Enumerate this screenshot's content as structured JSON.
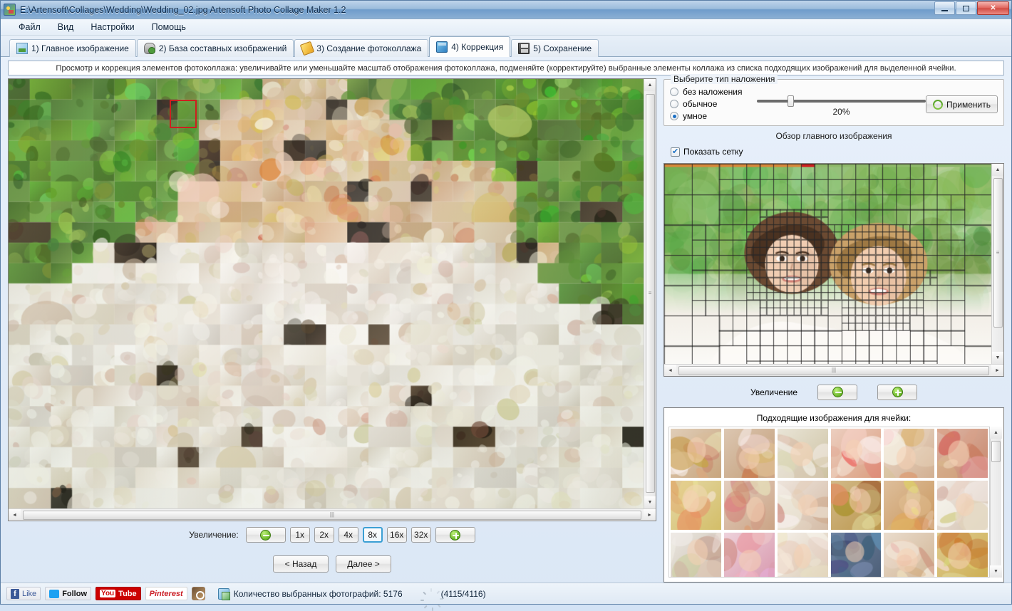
{
  "window": {
    "title": "E:\\Artensoft\\Collages\\Wedding\\Wedding_02.jpg Artensoft Photo Collage Maker 1.2",
    "app_icon": "collage-app-icon",
    "minimize_label": "Свернуть",
    "maximize_label": "Развернуть",
    "close_label": "✕"
  },
  "menubar": {
    "items": [
      {
        "label": "Файл",
        "name": "menu-file"
      },
      {
        "label": "Вид",
        "name": "menu-view"
      },
      {
        "label": "Настройки",
        "name": "menu-settings"
      },
      {
        "label": "Помощь",
        "name": "menu-help"
      }
    ]
  },
  "tabs": [
    {
      "label": "1) Главное изображение",
      "icon": "picture-icon",
      "active": false
    },
    {
      "label": "2) База составных изображений",
      "icon": "database-icon",
      "active": false
    },
    {
      "label": "3) Создание фотоколлажа",
      "icon": "magic-wand-icon",
      "active": false
    },
    {
      "label": "4) Коррекция",
      "icon": "box-icon",
      "active": true
    },
    {
      "label": "5) Сохранение",
      "icon": "floppy-disk-icon",
      "active": false
    }
  ],
  "hint": "Просмотр и коррекция элементов фотоколлажа: увеличивайте или уменьшайте масштаб отображения фотоколлажа, подменяйте (корректируйте) выбранные элементы коллажа из списка подходящих изображений для выделенной ячейки.",
  "preview": {
    "selected_cell_color": "#cd1f1f",
    "zoom": {
      "label": "Увеличение:",
      "zoom_out_icon": "zoom-out-icon",
      "zoom_in_icon": "zoom-in-icon",
      "levels": [
        "1x",
        "2x",
        "4x",
        "8x",
        "16x",
        "32x"
      ],
      "selected_level": "8x",
      "selected_border_color": "#3b9fd4"
    }
  },
  "navigation": {
    "back_label": "< Назад",
    "next_label": "Далее >"
  },
  "overlay": {
    "group_title": "Выберите тип наложения",
    "options": [
      {
        "label": "без наложения",
        "selected": false
      },
      {
        "label": "обычное",
        "selected": false
      },
      {
        "label": "умное",
        "selected": true
      }
    ],
    "slider_value": "20%",
    "slider_percent": 20,
    "apply_label": "Применить",
    "apply_icon": "refresh-icon"
  },
  "main_image": {
    "section_label": "Обзор главного изображения",
    "show_grid_label": "Показать сетку",
    "show_grid_checked": true,
    "zoom_label": "Увеличение",
    "zoom_out_icon": "zoom-out-icon",
    "zoom_in_icon": "zoom-in-icon"
  },
  "matches": {
    "title": "Подходящие изображения для ячейки:",
    "columns": 6,
    "rows": 3,
    "thumbnails": [
      "bride-portrait",
      "bride-upside-down",
      "dress-detail",
      "girl-pink-dress",
      "child-smiling",
      "hands-flowers",
      "lilies-bouquet",
      "hands-ring",
      "hands-clasped",
      "groom-boutonniere",
      "hands-bread",
      "blonde-woman",
      "beach-scene",
      "girl-pink-bow",
      "blonde-smiling",
      "couple-kiss",
      "woman-beige",
      "bouquet-sunflowers"
    ]
  },
  "statusbar": {
    "social": [
      {
        "label": "Like",
        "name": "facebook-like-button"
      },
      {
        "label": "Follow",
        "name": "twitter-follow-button"
      },
      {
        "label": "You Tube",
        "name": "youtube-button"
      },
      {
        "label": "Pinterest",
        "name": "pinterest-button"
      },
      {
        "label": "",
        "name": "instagram-button"
      }
    ],
    "count_label": "Количество выбранных фотографий: 5176",
    "progress_label": "(4115/4116)"
  },
  "scrollbars": {
    "up_arrow": "▲",
    "down_arrow": "▼",
    "left_arrow": "◄",
    "right_arrow": "►",
    "grip": "|||"
  }
}
